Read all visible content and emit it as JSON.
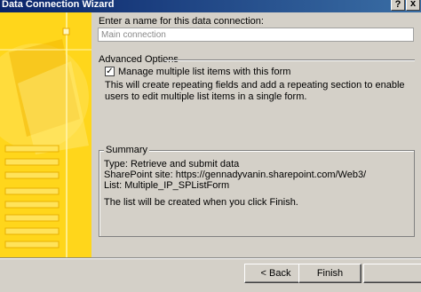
{
  "window": {
    "title": "Data Connection Wizard",
    "help_glyph": "?",
    "close_glyph": "x"
  },
  "form": {
    "name_label": "Enter a name for this data connection:",
    "name_value": "Main connection",
    "advanced_label": "Advanced Options",
    "checkbox_checked": true,
    "checkbox_label": "Manage multiple list items with this form",
    "description": "This will create repeating fields and add a repeating section to enable users to edit multiple list items in a single form."
  },
  "summary": {
    "legend": "Summary",
    "type_line": "Type: Retrieve and submit data",
    "site_line": "SharePoint site: https://gennadyvanin.sharepoint.com/Web3/",
    "list_line": "List: Multiple_IP_SPListForm",
    "note": "The list will be created when you click Finish."
  },
  "buttons": {
    "back": "< Back",
    "finish": "Finish",
    "cancel": ""
  },
  "colors": {
    "sidebar": "#ffd200",
    "titlebar": "#0a246a",
    "face": "#d4d0c8"
  }
}
